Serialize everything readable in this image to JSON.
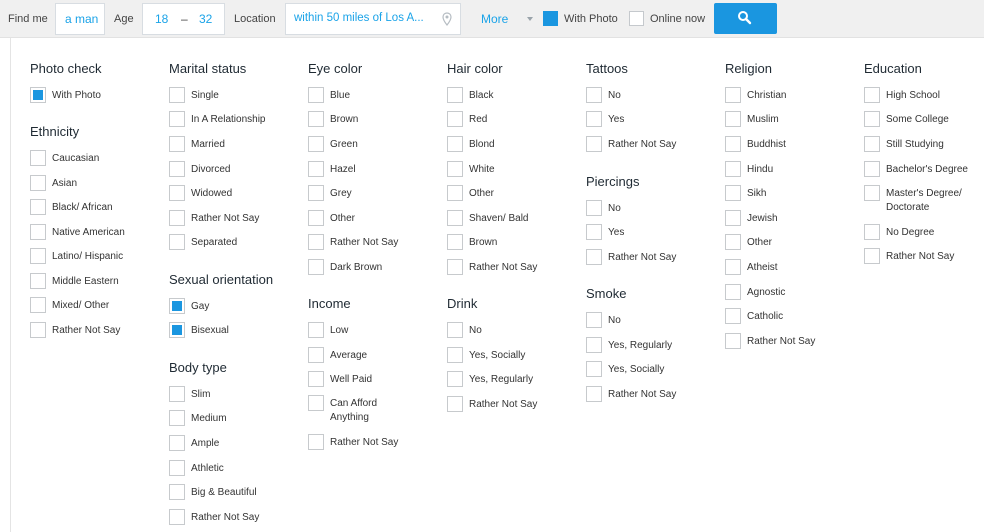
{
  "search": {
    "find_me_label": "Find me",
    "find_me_value": "a man",
    "age_label": "Age",
    "age_min": "18",
    "age_sep": "–",
    "age_max": "32",
    "location_label": "Location",
    "location_value": "within 50 miles of Los A...",
    "more_label": "More",
    "with_photo_label": "With Photo",
    "with_photo_checked": true,
    "online_now_label": "Online now",
    "online_now_checked": false
  },
  "filters": {
    "photo_check": {
      "title": "Photo check",
      "options": [
        {
          "label": "With Photo",
          "checked": true
        }
      ]
    },
    "ethnicity": {
      "title": "Ethnicity",
      "options": [
        {
          "label": "Caucasian",
          "checked": false
        },
        {
          "label": "Asian",
          "checked": false
        },
        {
          "label": "Black/ African",
          "checked": false
        },
        {
          "label": "Native American",
          "checked": false
        },
        {
          "label": "Latino/ Hispanic",
          "checked": false
        },
        {
          "label": "Middle Eastern",
          "checked": false
        },
        {
          "label": "Mixed/ Other",
          "checked": false
        },
        {
          "label": "Rather Not Say",
          "checked": false
        }
      ]
    },
    "marital_status": {
      "title": "Marital status",
      "options": [
        {
          "label": "Single",
          "checked": false
        },
        {
          "label": "In A Relationship",
          "checked": false
        },
        {
          "label": "Married",
          "checked": false
        },
        {
          "label": "Divorced",
          "checked": false
        },
        {
          "label": "Widowed",
          "checked": false
        },
        {
          "label": "Rather Not Say",
          "checked": false
        },
        {
          "label": "Separated",
          "checked": false
        }
      ]
    },
    "sexual_orientation": {
      "title": "Sexual orientation",
      "options": [
        {
          "label": "Gay",
          "checked": true
        },
        {
          "label": "Bisexual",
          "checked": true
        }
      ]
    },
    "body_type": {
      "title": "Body type",
      "options": [
        {
          "label": "Slim",
          "checked": false
        },
        {
          "label": "Medium",
          "checked": false
        },
        {
          "label": "Ample",
          "checked": false
        },
        {
          "label": "Athletic",
          "checked": false
        },
        {
          "label": "Big & Beautiful",
          "checked": false
        },
        {
          "label": "Rather Not Say",
          "checked": false
        }
      ]
    },
    "eye_color": {
      "title": "Eye color",
      "options": [
        {
          "label": "Blue",
          "checked": false
        },
        {
          "label": "Brown",
          "checked": false
        },
        {
          "label": "Green",
          "checked": false
        },
        {
          "label": "Hazel",
          "checked": false
        },
        {
          "label": "Grey",
          "checked": false
        },
        {
          "label": "Other",
          "checked": false
        },
        {
          "label": "Rather Not Say",
          "checked": false
        },
        {
          "label": "Dark Brown",
          "checked": false
        }
      ]
    },
    "income": {
      "title": "Income",
      "options": [
        {
          "label": "Low",
          "checked": false
        },
        {
          "label": "Average",
          "checked": false
        },
        {
          "label": "Well Paid",
          "checked": false
        },
        {
          "label": "Can Afford Anything",
          "checked": false
        },
        {
          "label": "Rather Not Say",
          "checked": false
        }
      ]
    },
    "hair_color": {
      "title": "Hair color",
      "options": [
        {
          "label": "Black",
          "checked": false
        },
        {
          "label": "Red",
          "checked": false
        },
        {
          "label": "Blond",
          "checked": false
        },
        {
          "label": "White",
          "checked": false
        },
        {
          "label": "Other",
          "checked": false
        },
        {
          "label": "Shaven/ Bald",
          "checked": false
        },
        {
          "label": "Brown",
          "checked": false
        },
        {
          "label": "Rather Not Say",
          "checked": false
        }
      ]
    },
    "drink": {
      "title": "Drink",
      "options": [
        {
          "label": "No",
          "checked": false
        },
        {
          "label": "Yes, Socially",
          "checked": false
        },
        {
          "label": "Yes, Regularly",
          "checked": false
        },
        {
          "label": "Rather Not Say",
          "checked": false
        }
      ]
    },
    "tattoos": {
      "title": "Tattoos",
      "options": [
        {
          "label": "No",
          "checked": false
        },
        {
          "label": "Yes",
          "checked": false
        },
        {
          "label": "Rather Not Say",
          "checked": false
        }
      ]
    },
    "piercings": {
      "title": "Piercings",
      "options": [
        {
          "label": "No",
          "checked": false
        },
        {
          "label": "Yes",
          "checked": false
        },
        {
          "label": "Rather Not Say",
          "checked": false
        }
      ]
    },
    "smoke": {
      "title": "Smoke",
      "options": [
        {
          "label": "No",
          "checked": false
        },
        {
          "label": "Yes, Regularly",
          "checked": false
        },
        {
          "label": "Yes, Socially",
          "checked": false
        },
        {
          "label": "Rather Not Say",
          "checked": false
        }
      ]
    },
    "religion": {
      "title": "Religion",
      "options": [
        {
          "label": "Christian",
          "checked": false
        },
        {
          "label": "Muslim",
          "checked": false
        },
        {
          "label": "Buddhist",
          "checked": false
        },
        {
          "label": "Hindu",
          "checked": false
        },
        {
          "label": "Sikh",
          "checked": false
        },
        {
          "label": "Jewish",
          "checked": false
        },
        {
          "label": "Other",
          "checked": false
        },
        {
          "label": "Atheist",
          "checked": false
        },
        {
          "label": "Agnostic",
          "checked": false
        },
        {
          "label": "Catholic",
          "checked": false
        },
        {
          "label": "Rather Not Say",
          "checked": false
        }
      ]
    },
    "education": {
      "title": "Education",
      "options": [
        {
          "label": "High School",
          "checked": false
        },
        {
          "label": "Some College",
          "checked": false
        },
        {
          "label": "Still Studying",
          "checked": false
        },
        {
          "label": "Bachelor's Degree",
          "checked": false
        },
        {
          "label": "Master's Degree/ Doctorate",
          "checked": false
        },
        {
          "label": "No Degree",
          "checked": false
        },
        {
          "label": "Rather Not Say",
          "checked": false
        }
      ]
    }
  },
  "icons": {
    "location": "location-pin-icon",
    "search": "magnifier-icon",
    "more": "caret-down-icon"
  },
  "colors": {
    "accent": "#1a96e0",
    "bar": "#f0f0f0"
  }
}
